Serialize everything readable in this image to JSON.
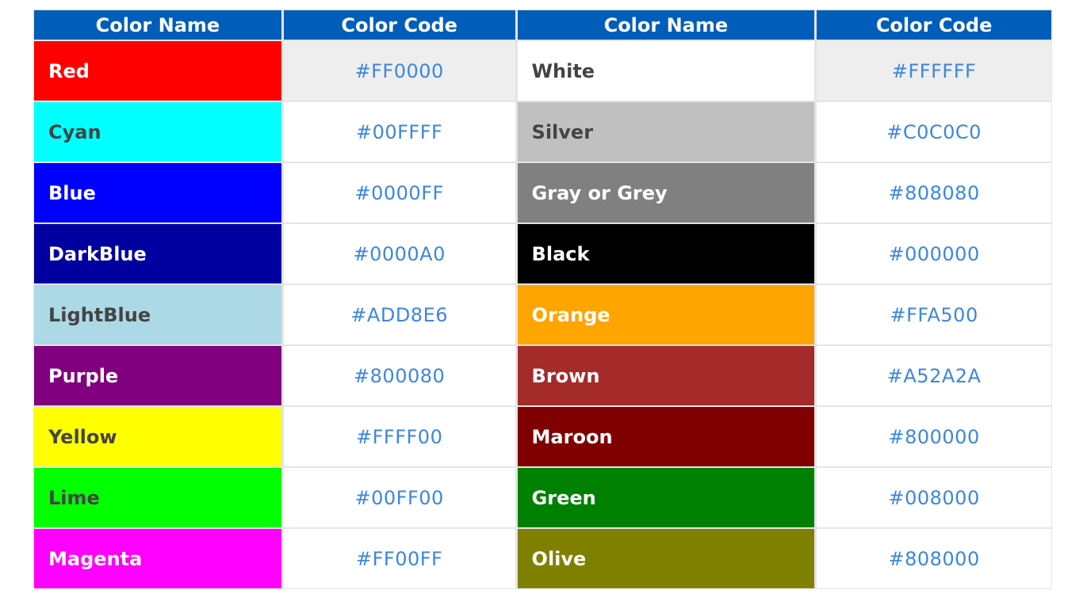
{
  "headers": [
    "Color Name",
    "Color Code",
    "Color Name",
    "Color Code"
  ],
  "rows": [
    {
      "left": {
        "name": "Red",
        "code": "#FF0000",
        "bg": "#FF0000",
        "fg": "#FFFFFF"
      },
      "right": {
        "name": "White",
        "code": "#FFFFFF",
        "bg": "#FFFFFF",
        "fg": "#444444"
      }
    },
    {
      "left": {
        "name": "Cyan",
        "code": "#00FFFF",
        "bg": "#00FFFF",
        "fg": "#444444"
      },
      "right": {
        "name": "Silver",
        "code": "#C0C0C0",
        "bg": "#C0C0C0",
        "fg": "#444444"
      }
    },
    {
      "left": {
        "name": "Blue",
        "code": "#0000FF",
        "bg": "#0000FF",
        "fg": "#FFFFFF"
      },
      "right": {
        "name": "Gray or Grey",
        "code": "#808080",
        "bg": "#808080",
        "fg": "#FFFFFF"
      }
    },
    {
      "left": {
        "name": "DarkBlue",
        "code": "#0000A0",
        "bg": "#0000A0",
        "fg": "#FFFFFF"
      },
      "right": {
        "name": "Black",
        "code": "#000000",
        "bg": "#000000",
        "fg": "#FFFFFF"
      }
    },
    {
      "left": {
        "name": "LightBlue",
        "code": "#ADD8E6",
        "bg": "#ADD8E6",
        "fg": "#444444"
      },
      "right": {
        "name": "Orange",
        "code": "#FFA500",
        "bg": "#FFA500",
        "fg": "#FFFFFF"
      }
    },
    {
      "left": {
        "name": "Purple",
        "code": "#800080",
        "bg": "#800080",
        "fg": "#FFFFFF"
      },
      "right": {
        "name": "Brown",
        "code": "#A52A2A",
        "bg": "#A52A2A",
        "fg": "#FFFFFF"
      }
    },
    {
      "left": {
        "name": "Yellow",
        "code": "#FFFF00",
        "bg": "#FFFF00",
        "fg": "#444444"
      },
      "right": {
        "name": "Maroon",
        "code": "#800000",
        "bg": "#800000",
        "fg": "#FFFFFF"
      }
    },
    {
      "left": {
        "name": "Lime",
        "code": "#00FF00",
        "bg": "#00FF00",
        "fg": "#444444"
      },
      "right": {
        "name": "Green",
        "code": "#008000",
        "bg": "#008000",
        "fg": "#FFFFFF"
      }
    },
    {
      "left": {
        "name": "Magenta",
        "code": "#FF00FF",
        "bg": "#FF00FF",
        "fg": "#FFFFFF"
      },
      "right": {
        "name": "Olive",
        "code": "#808000",
        "bg": "#808000",
        "fg": "#FFFFFF"
      }
    }
  ],
  "colors": {
    "header_bg": "#005EBA",
    "code_text": "#3D86E0",
    "border": "#E4E4E4",
    "alt_row_bg": "#EEEEEE"
  }
}
